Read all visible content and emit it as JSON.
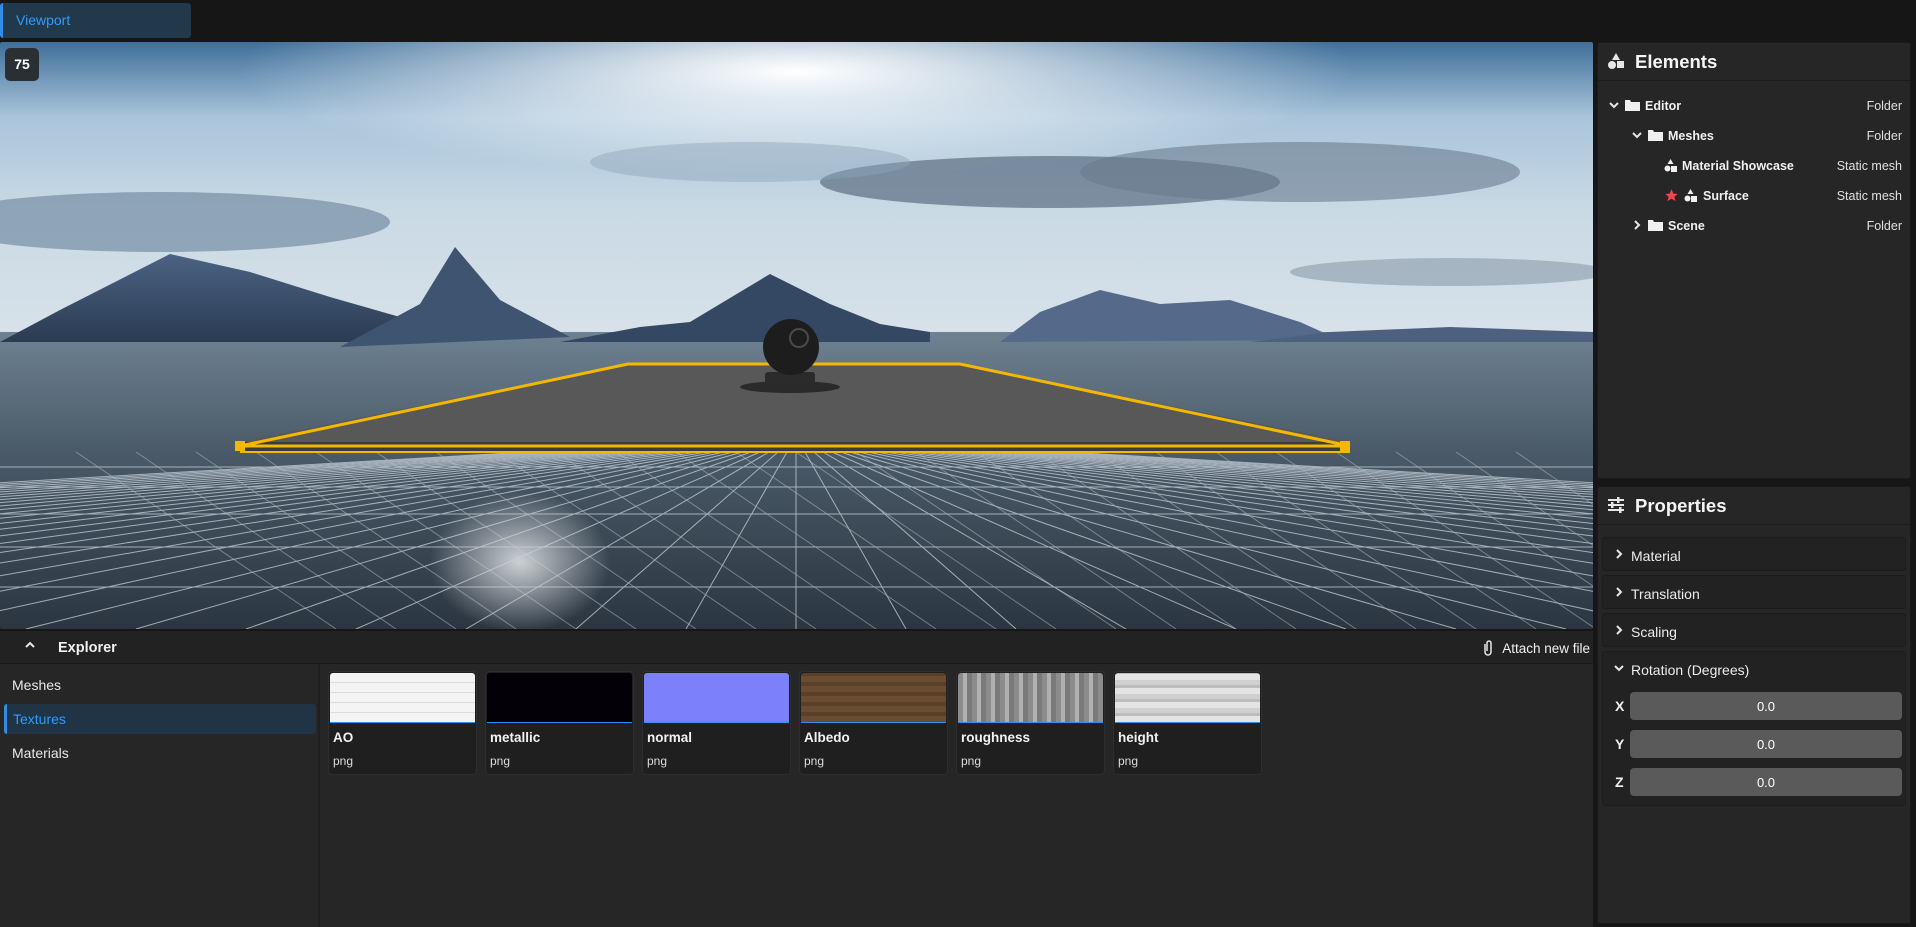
{
  "tabs": [
    {
      "label": "Viewport"
    }
  ],
  "viewport": {
    "fps": "75"
  },
  "explorer": {
    "title": "Explorer",
    "attach_label": "Attach new file",
    "categories": [
      {
        "label": "Meshes"
      },
      {
        "label": "Textures"
      },
      {
        "label": "Materials"
      }
    ],
    "active_category": "Textures",
    "files": [
      {
        "name": "AO",
        "ext": "png",
        "thumb_color": "#f4f4f4"
      },
      {
        "name": "metallic",
        "ext": "png",
        "thumb_color": "#030008"
      },
      {
        "name": "normal",
        "ext": "png",
        "thumb_color": "#7d80fb"
      },
      {
        "name": "Albedo",
        "ext": "png",
        "thumb_color": "#6a4c31"
      },
      {
        "name": "roughness",
        "ext": "png",
        "thumb_color": "#9a9a9a"
      },
      {
        "name": "height",
        "ext": "png",
        "thumb_color": "#d6d6d6"
      }
    ]
  },
  "elements": {
    "title": "Elements",
    "tree": [
      {
        "label": "Editor",
        "kind": "Folder",
        "icon": "folder-icon",
        "expanded": true
      },
      {
        "label": "Meshes",
        "kind": "Folder",
        "icon": "folder-icon",
        "expanded": true
      },
      {
        "label": "Material Showcase",
        "kind": "Static mesh",
        "icon": "mesh-icon"
      },
      {
        "label": "Surface",
        "kind": "Static mesh",
        "icon": "mesh-icon",
        "starred": true
      },
      {
        "label": "Scene",
        "kind": "Folder",
        "icon": "folder-icon",
        "expanded": false
      }
    ]
  },
  "properties": {
    "title": "Properties",
    "sections": [
      {
        "label": "Material",
        "expanded": false
      },
      {
        "label": "Translation",
        "expanded": false
      },
      {
        "label": "Scaling",
        "expanded": false
      },
      {
        "label": "Rotation (Degrees)",
        "expanded": true
      }
    ],
    "rotation": {
      "x_label": "X",
      "x": "0.0",
      "y_label": "Y",
      "y": "0.0",
      "z_label": "Z",
      "z": "0.0"
    }
  },
  "colors": {
    "accent": "#2f8ee5",
    "selection_outline": "#f5b800",
    "star": "#e84a4a"
  }
}
